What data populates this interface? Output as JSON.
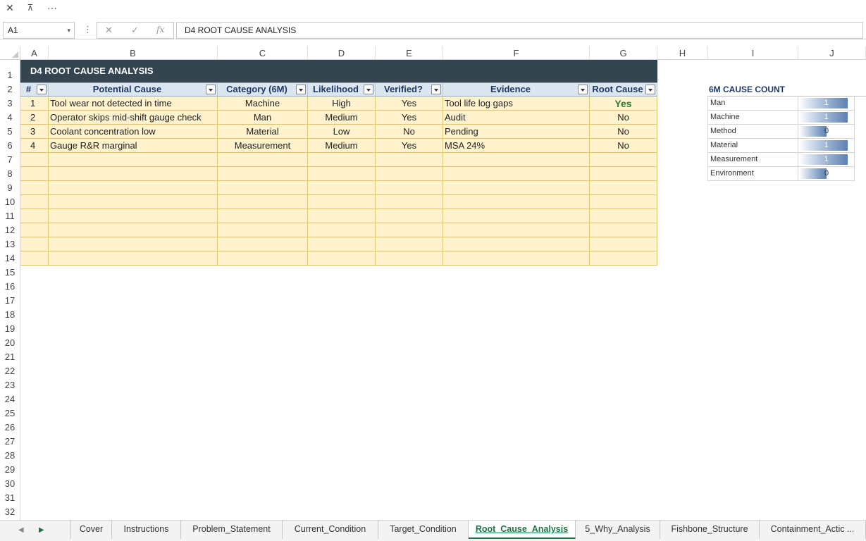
{
  "toolbar": {
    "close_glyph": "✕",
    "restore_glyph": "⊼",
    "more_glyph": "···"
  },
  "formula_bar": {
    "name_box": "A1",
    "name_dropdown": "▾",
    "separator": "⋮",
    "cancel_glyph": "✕",
    "confirm_glyph": "✓",
    "fx_glyph": "fx",
    "formula": "D4  ROOT CAUSE ANALYSIS"
  },
  "columns": [
    "A",
    "B",
    "C",
    "D",
    "E",
    "F",
    "G",
    "H",
    "I",
    "J"
  ],
  "rows": [
    "1",
    "2",
    "3",
    "4",
    "5",
    "6",
    "7",
    "8",
    "9",
    "10",
    "11",
    "12",
    "13",
    "14",
    "15",
    "16",
    "17",
    "18",
    "19",
    "20",
    "21",
    "22",
    "23",
    "24",
    "25",
    "26",
    "27",
    "28",
    "29",
    "30",
    "31",
    "32",
    "33"
  ],
  "sheet": {
    "title": "D4  ROOT CAUSE ANALYSIS",
    "headers": [
      "#",
      "Potential Cause",
      "Category (6M)",
      "Likelihood",
      "Verified?",
      "Evidence",
      "Root Cause"
    ],
    "data_rows": [
      [
        "1",
        "Tool wear not detected in time",
        "Machine",
        "High",
        "Yes",
        "Tool life log gaps",
        "Yes"
      ],
      [
        "2",
        "Operator skips mid-shift gauge check",
        "Man",
        "Medium",
        "Yes",
        "Audit",
        "No"
      ],
      [
        "3",
        "Coolant concentration low",
        "Material",
        "Low",
        "No",
        "Pending",
        "No"
      ],
      [
        "4",
        "Gauge R&R marginal",
        "Measurement",
        "Medium",
        "Yes",
        "MSA 24%",
        "No"
      ]
    ],
    "empty_row_count": 8
  },
  "cause_count": {
    "title": "6M CAUSE COUNT",
    "items": [
      {
        "label": "Man",
        "value": 1
      },
      {
        "label": "Machine",
        "value": 1
      },
      {
        "label": "Method",
        "value": 0
      },
      {
        "label": "Material",
        "value": 1
      },
      {
        "label": "Measurement",
        "value": 1
      },
      {
        "label": "Environment",
        "value": 0
      }
    ],
    "max_value": 1,
    "bar_color": "#5b7fb1"
  },
  "tabs": {
    "prev_glyph": "◀",
    "next_glyph": "▶",
    "items": [
      "Cover",
      "Instructions",
      "Problem_Statement",
      "Current_Condition",
      "Target_Condition",
      "Root_Cause_Analysis",
      "5_Why_Analysis",
      "Fishbone_Structure",
      "Containment_Actic ..."
    ],
    "active_index": 5
  },
  "colors": {
    "title_band": "#344550",
    "header_fill": "#dce6f1",
    "body_fill": "#fff2cc",
    "accent_green": "#217346",
    "root_cause_yes": "#2e7d32"
  }
}
